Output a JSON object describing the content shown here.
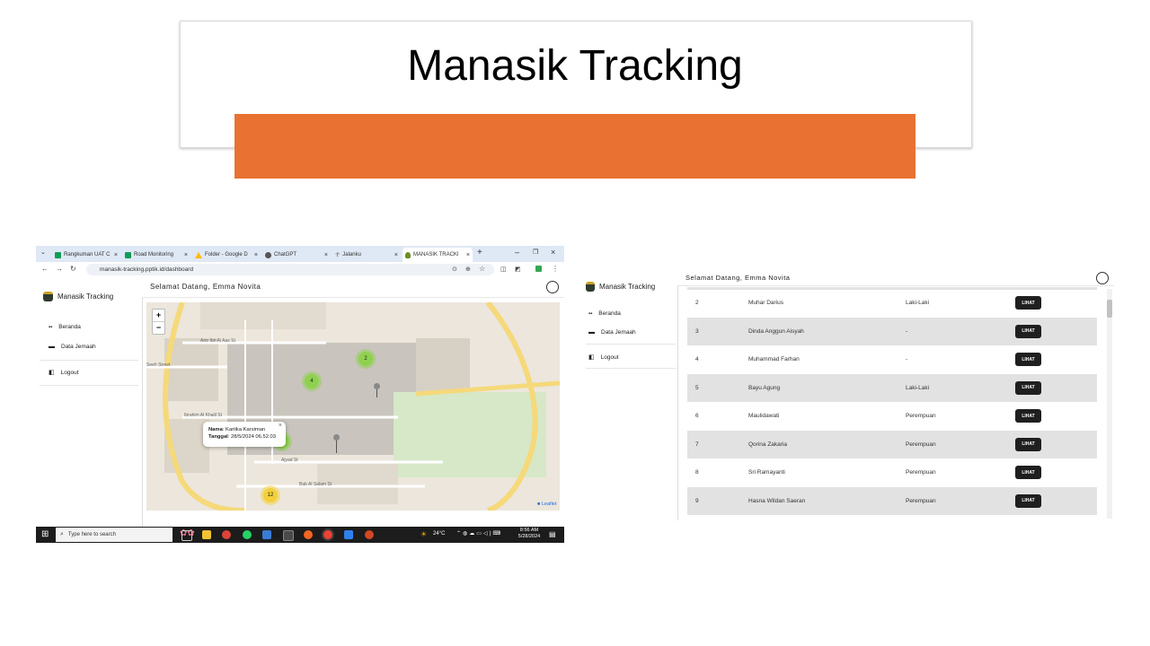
{
  "slide": {
    "title": "Manasik Tracking",
    "accent_color": "#e97132"
  },
  "browser": {
    "tabs": [
      {
        "label": "Rangkuman UAT C",
        "icon": "sheets-icon",
        "icon_color": "#0f9d58"
      },
      {
        "label": "Road Monitoring",
        "icon": "sheets-icon",
        "icon_color": "#0f9d58"
      },
      {
        "label": "Folder - Google D",
        "icon": "drive-icon",
        "icon_color": "#fbbc04"
      },
      {
        "label": "ChatGPT",
        "icon": "chatgpt-icon",
        "icon_color": "#555555"
      },
      {
        "label": "Jalanku",
        "icon": "walk-icon",
        "icon_color": "#555555"
      },
      {
        "label": "MANASIK TRACKI",
        "icon": "app-icon",
        "icon_color": "#6b8e23"
      }
    ],
    "url": "manasik-tracking.pptik.id/dashboard"
  },
  "app": {
    "name": "Manasik Tracking",
    "greeting": "Selamat Datang, Emma Novita",
    "menu": {
      "home": "Beranda",
      "data": "Data Jemaah",
      "logout": "Logout"
    }
  },
  "map": {
    "zoom_in": "+",
    "zoom_out": "−",
    "clusters": {
      "c1": "2",
      "c2": "4",
      "c3": "12"
    },
    "popup": {
      "name_label": "Nama",
      "name_value": ": Kartika Karsiman",
      "date_label": "Tanggal",
      "date_value": ": 28/5/2024 06.52.03",
      "close": "×"
    },
    "attribution": "Leaflet",
    "street_labels": {
      "s1": "Amr Ibn Al Aas St",
      "s2": "Seeh Street",
      "s3": "Ibrahim Al Khalil St",
      "s4": "Ajyad St",
      "s5": "Bab Al Salam St",
      "s6": "Ibrahim Al Khalil St"
    }
  },
  "taskbar": {
    "search": "Type here to search",
    "temp": "24°C",
    "time": "8:56 AM",
    "date": "5/28/2024"
  },
  "table": {
    "view_label": "LIHAT",
    "rows": [
      {
        "no": "2",
        "name": "Muhar Darius",
        "gender": "Laki-Laki"
      },
      {
        "no": "3",
        "name": "Dinda Anggun Aisyah",
        "gender": "-"
      },
      {
        "no": "4",
        "name": "Muhammad Farhan",
        "gender": "-"
      },
      {
        "no": "5",
        "name": "Bayu Agung",
        "gender": "Laki-Laki"
      },
      {
        "no": "6",
        "name": "Maulidawati",
        "gender": "Perempuan"
      },
      {
        "no": "7",
        "name": "Qorina Zakaria",
        "gender": "Perempuan"
      },
      {
        "no": "8",
        "name": "Sri Ramayanti",
        "gender": "Perempuan"
      },
      {
        "no": "9",
        "name": "Hasna Wildan Saeran",
        "gender": "Perempuan"
      }
    ]
  }
}
